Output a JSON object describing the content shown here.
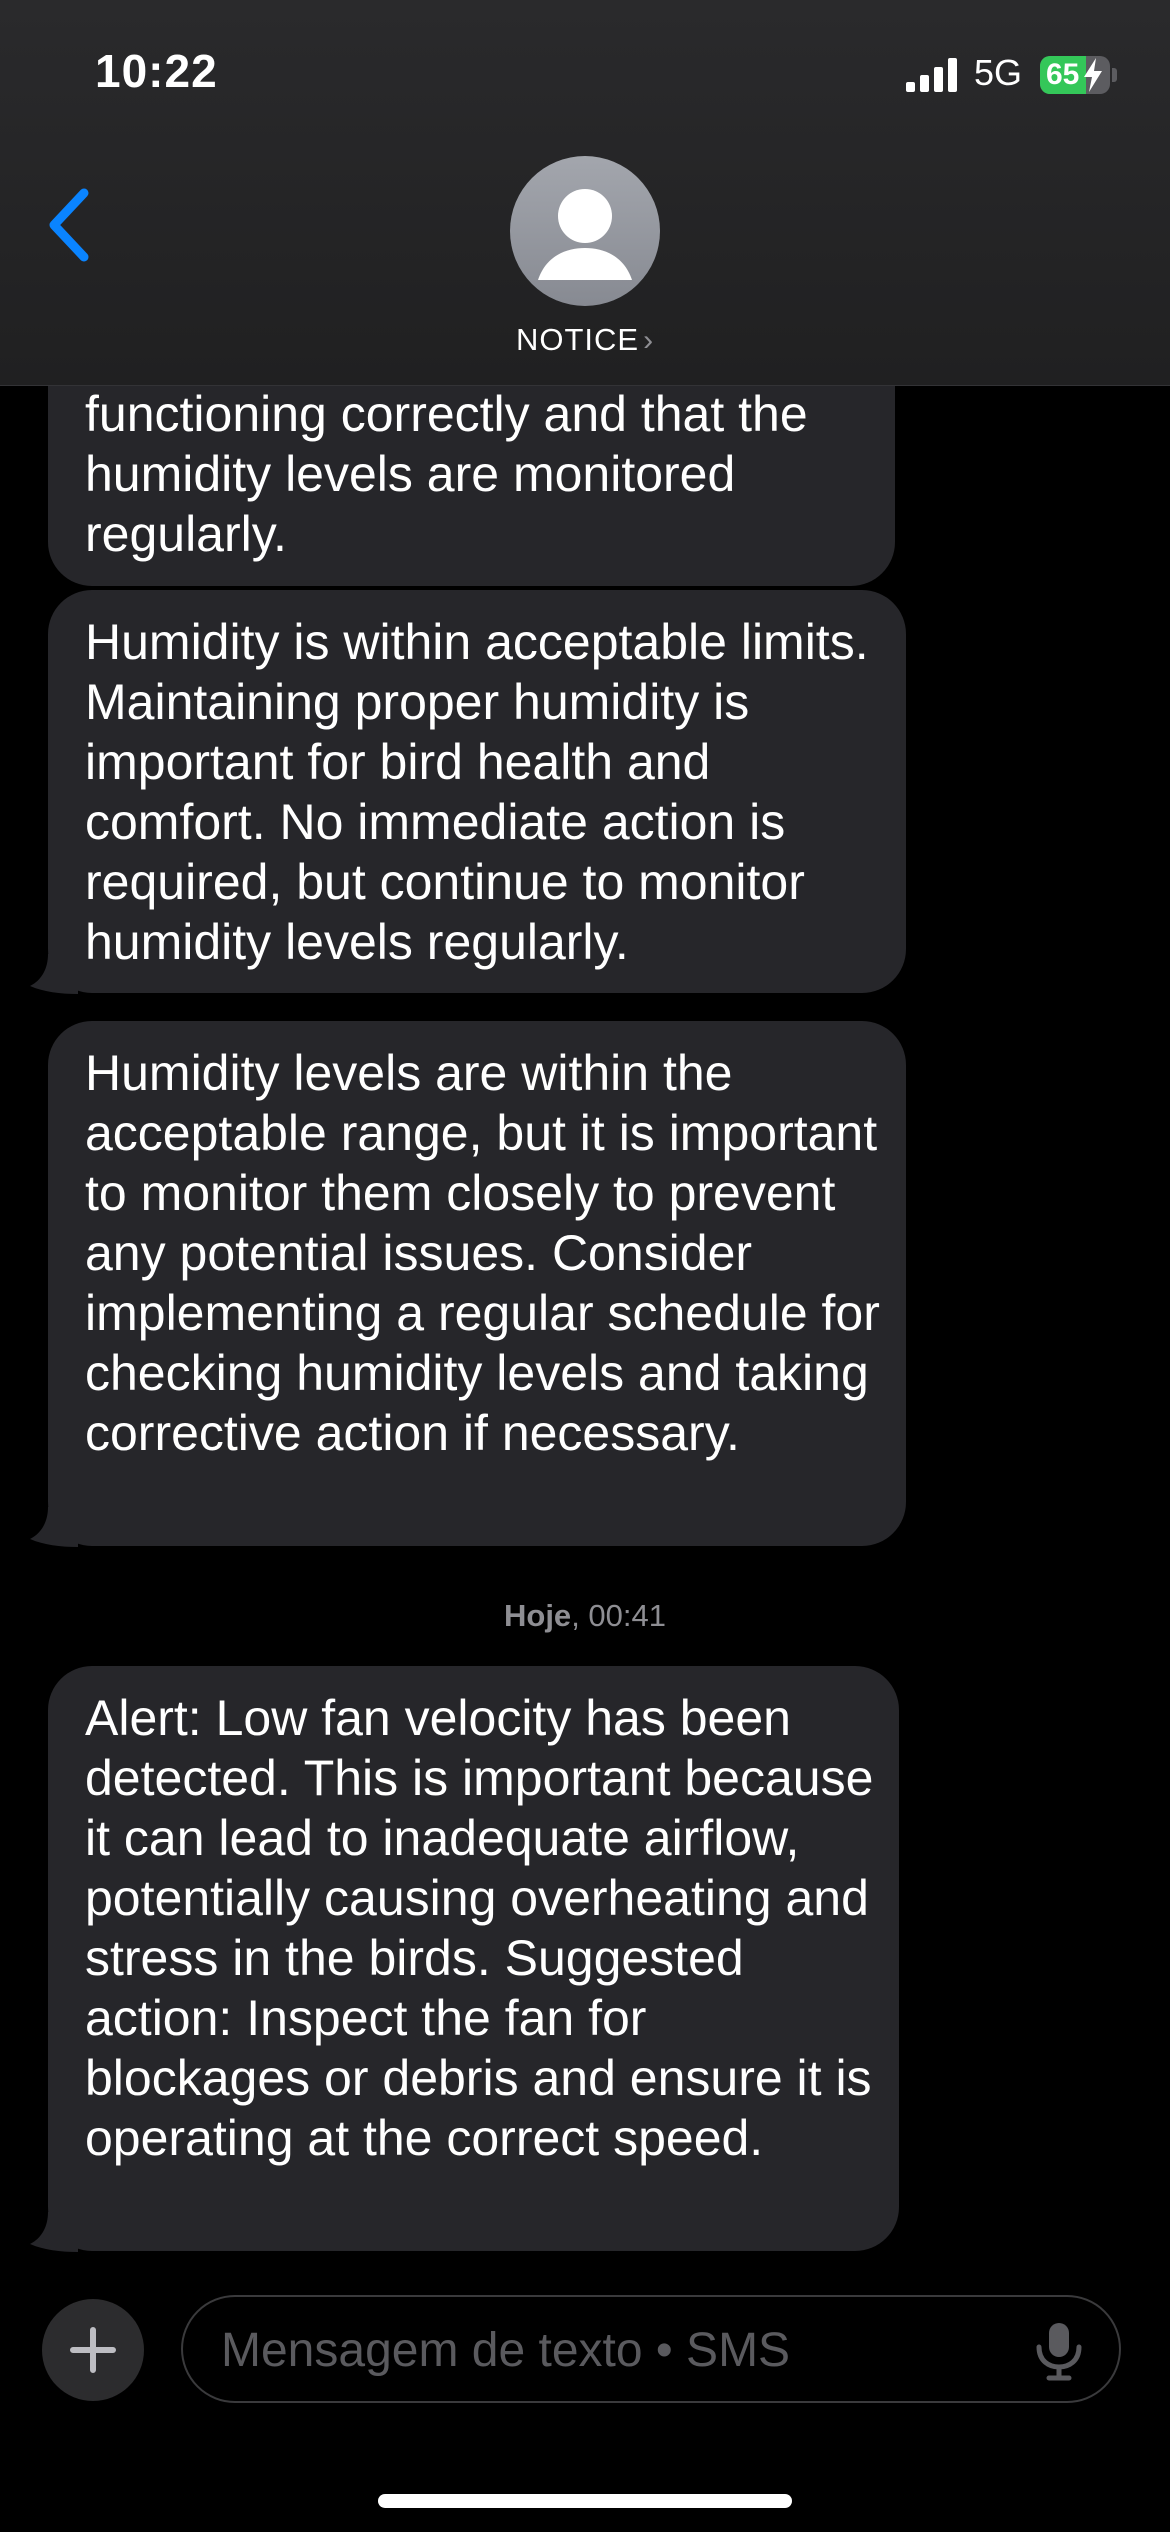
{
  "status_bar": {
    "time": "10:22",
    "network": "5G",
    "battery_level": "65",
    "battery_fraction": 0.65
  },
  "header": {
    "contact_name": "NOTICE",
    "chevron": "›"
  },
  "conversation": {
    "messages": [
      {
        "text": "functioning correctly and that the humidity levels are monitored regularly."
      },
      {
        "text": "Humidity is within acceptable limits. Maintaining proper humidity is important for bird health and comfort. No immediate action is required, but continue to monitor humidity levels regularly."
      },
      {
        "text": "Humidity levels are within the acceptable range, but it is important to monitor them closely to prevent any potential issues. Consider implementing a regular schedule for checking humidity levels and taking corrective action if necessary."
      },
      {
        "text": "Alert: Low fan velocity has been detected. This is important because it can lead to inadequate airflow, potentially causing overheating and stress in the birds. Suggested action: Inspect the fan for blockages or debris and ensure it is operating at the correct speed."
      }
    ],
    "timestamp": {
      "day": "Hoje",
      "time": ", 00:41"
    }
  },
  "composer": {
    "placeholder": "Mensagem de texto • SMS"
  },
  "icons": {
    "back": "chevron-left-icon",
    "avatar": "person-silhouette-icon",
    "add": "plus-icon",
    "mic": "microphone-icon",
    "signal": "cellular-signal-icon",
    "battery": "battery-charging-icon"
  },
  "colors": {
    "accent": "#0a84ff",
    "incoming_bubble": "#26262a",
    "battery_fill": "#34c759",
    "secondary_text": "#8e8e93"
  }
}
